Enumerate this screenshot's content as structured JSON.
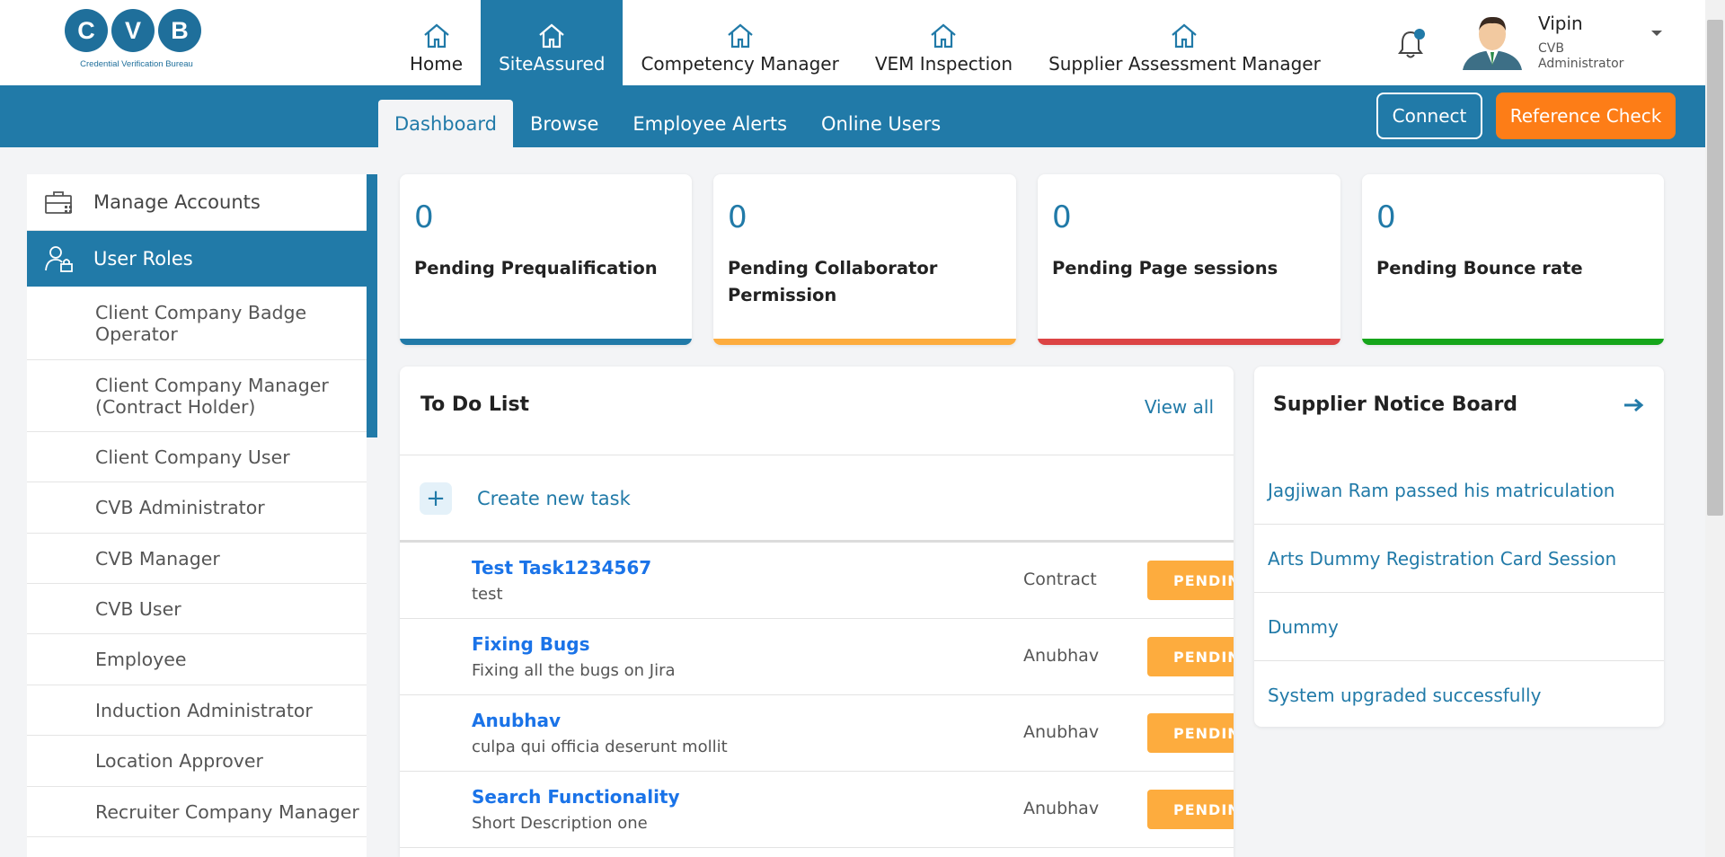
{
  "logo": {
    "letters": [
      "C",
      "V",
      "B"
    ],
    "tagline": "Credential Verification Bureau"
  },
  "top_nav": [
    {
      "label": "Home",
      "icon": "home-icon",
      "active": false
    },
    {
      "label": "SiteAssured",
      "icon": "home-icon",
      "active": true
    },
    {
      "label": "Competency Manager",
      "icon": "home-icon",
      "active": false
    },
    {
      "label": "VEM Inspection",
      "icon": "home-icon",
      "active": false
    },
    {
      "label": "Supplier Assessment Manager",
      "icon": "home-icon",
      "active": false
    }
  ],
  "user": {
    "name": "Vipin",
    "role": "CVB Administrator"
  },
  "sub_nav": {
    "tabs": [
      {
        "label": "Dashboard",
        "active": true
      },
      {
        "label": "Browse",
        "active": false
      },
      {
        "label": "Employee Alerts",
        "active": false
      },
      {
        "label": "Online Users",
        "active": false
      }
    ],
    "connect_label": "Connect",
    "reference_label": "Reference Check"
  },
  "sidebar": {
    "headers": [
      {
        "label": "Manage Accounts",
        "icon": "briefcase-icon",
        "active": false
      },
      {
        "label": "User Roles",
        "icon": "user-lock-icon",
        "active": true
      }
    ],
    "items": [
      "Client Company Badge Operator",
      "Client Company Manager (Contract Holder)",
      "Client Company User",
      "CVB Administrator",
      "CVB Manager",
      "CVB User",
      "Employee",
      "Induction Administrator",
      "Location Approver",
      "Recruiter Company Manager"
    ]
  },
  "cards": [
    {
      "value": "0",
      "label": "Pending Prequalification",
      "color": "#217aa8"
    },
    {
      "value": "0",
      "label": "Pending Collaborator Permission",
      "color": "#fdac3e"
    },
    {
      "value": "0",
      "label": "Pending Page sessions",
      "color": "#dc4445"
    },
    {
      "value": "0",
      "label": "Pending Bounce rate",
      "color": "#16a51b"
    }
  ],
  "todo": {
    "title": "To Do List",
    "view_all": "View all",
    "create_label": "Create new task",
    "tasks": [
      {
        "title": "Test Task1234567",
        "desc": "test",
        "owner": "Contract",
        "status": "PENDING"
      },
      {
        "title": "Fixing Bugs",
        "desc": "Fixing all the bugs on Jira",
        "owner": "Anubhav",
        "status": "PENDING"
      },
      {
        "title": "Anubhav",
        "desc": "culpa qui officia deserunt mollit",
        "owner": "Anubhav",
        "status": "PENDING"
      },
      {
        "title": "Search Functionality",
        "desc": "Short Description one",
        "owner": "Anubhav",
        "status": "PENDING"
      }
    ]
  },
  "notice_board": {
    "title": "Supplier Notice Board",
    "items": [
      "Jagjiwan Ram passed his matriculation",
      "Arts Dummy Registration Card Session",
      "Dummy",
      "System upgraded successfully"
    ]
  },
  "colors": {
    "primary": "#217aa8",
    "accent": "#fd7d17",
    "pending": "#fdac3e"
  }
}
